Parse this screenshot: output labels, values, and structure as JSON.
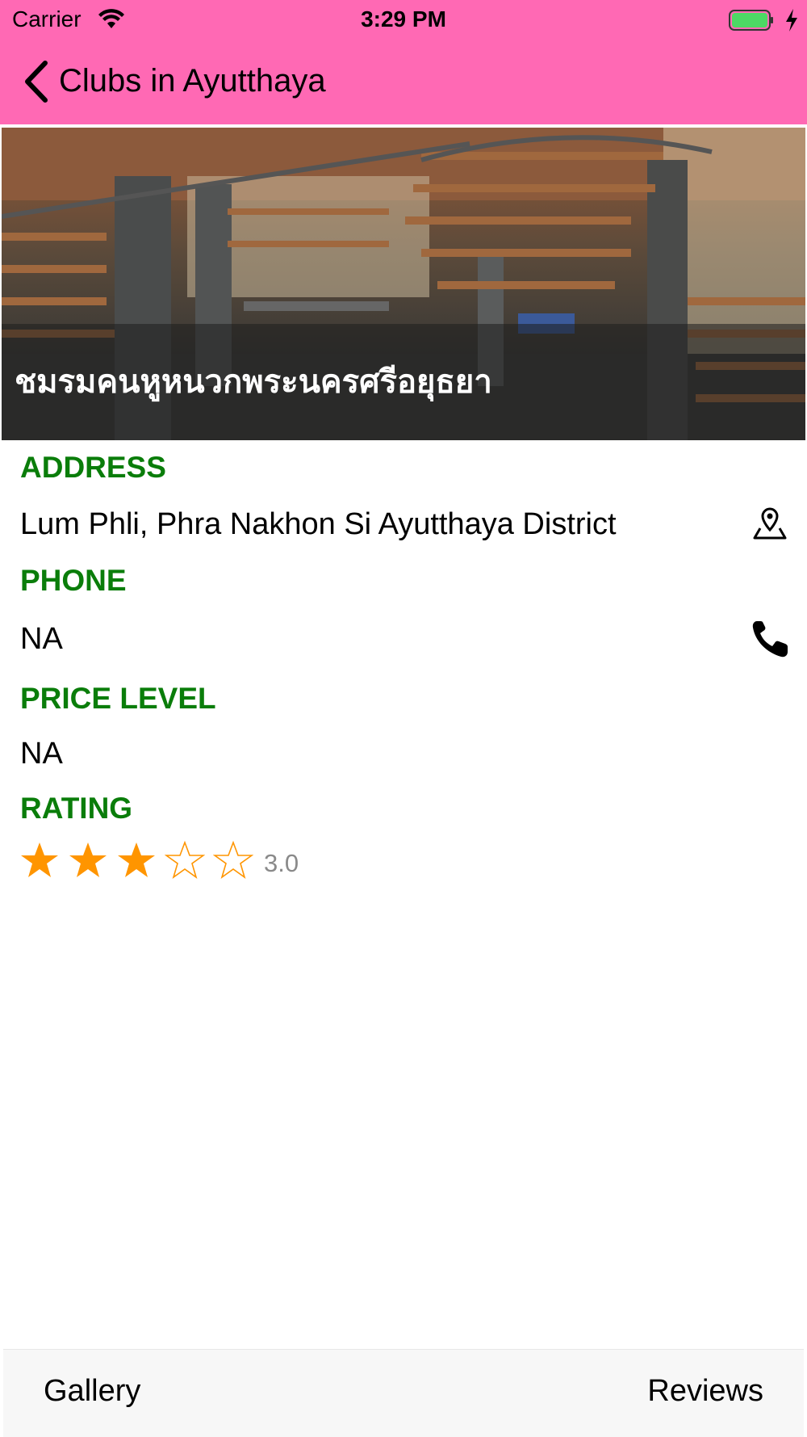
{
  "status_bar": {
    "carrier": "Carrier",
    "time": "3:29 PM",
    "battery_color": "#4cd964"
  },
  "nav": {
    "back_title": "Clubs in Ayutthaya",
    "bar_color": "#FF69B4"
  },
  "hero": {
    "title": "ชมรมคนหูหนวกพระนครศรีอยุธยา"
  },
  "details": {
    "address_label": "ADDRESS",
    "address_value": "Lum Phli, Phra Nakhon Si Ayutthaya District",
    "address_icon": "map-pin-icon",
    "phone_label": "PHONE",
    "phone_value": "NA",
    "phone_icon": "phone-icon",
    "price_label": "PRICE LEVEL",
    "price_value": "NA",
    "rating_label": "RATING",
    "rating_value": "3.0",
    "rating_stars_filled": 3,
    "rating_stars_total": 5,
    "label_color": "#0a7d0a",
    "star_color": "#ff9500"
  },
  "bottom_bar": {
    "gallery_label": "Gallery",
    "reviews_label": "Reviews"
  }
}
